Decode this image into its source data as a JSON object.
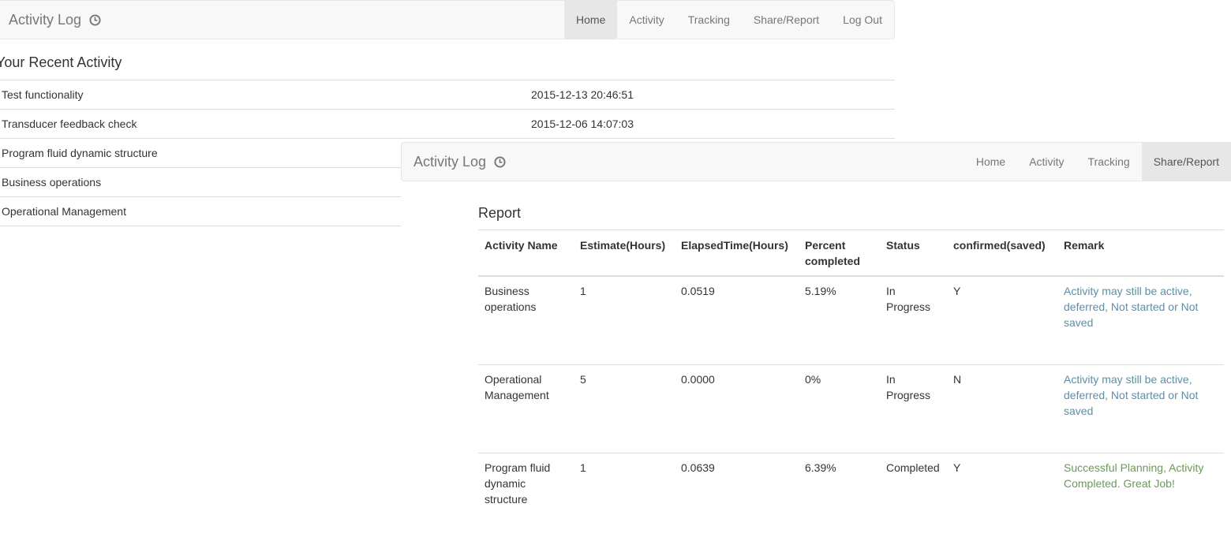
{
  "back_window": {
    "brand": "Activity Log",
    "nav": [
      "Home",
      "Activity",
      "Tracking",
      "Share/Report",
      "Log Out"
    ],
    "active_nav": "Home",
    "section_title": "Your Recent Activity",
    "recent": [
      {
        "name": "Test functionality",
        "time": "2015-12-13 20:46:51"
      },
      {
        "name": "Transducer feedback check",
        "time": "2015-12-06 14:07:03"
      },
      {
        "name": "Program fluid dynamic structure",
        "time": ""
      },
      {
        "name": "Business operations",
        "time": ""
      },
      {
        "name": "Operational Management",
        "time": ""
      }
    ]
  },
  "front_window": {
    "brand": "Activity Log",
    "nav": [
      "Home",
      "Activity",
      "Tracking",
      "Share/Report"
    ],
    "active_nav": "Share/Report",
    "report_title": "Report",
    "columns": [
      "Activity Name",
      "Estimate(Hours)",
      "ElapsedTime(Hours)",
      "Percent completed",
      "Status",
      "confirmed(saved)",
      "Remark"
    ],
    "rows": [
      {
        "name": "Business operations",
        "estimate": "1",
        "elapsed": "0.0519",
        "percent": "5.19%",
        "status": "In Progress",
        "confirmed": "Y",
        "remark": "Activity may still be active, deferred, Not started or Not saved",
        "remark_type": "info"
      },
      {
        "name": "Operational Management",
        "estimate": "5",
        "elapsed": "0.0000",
        "percent": "0%",
        "status": "In Progress",
        "confirmed": "N",
        "remark": "Activity may still be active, deferred, Not started or Not saved",
        "remark_type": "info"
      },
      {
        "name": "Program fluid dynamic structure",
        "estimate": "1",
        "elapsed": "0.0639",
        "percent": "6.39%",
        "status": "Completed",
        "confirmed": "Y",
        "remark": "Successful Planning, Activity Completed. Great Job!",
        "remark_type": "success"
      }
    ]
  },
  "colors": {
    "info_remark": "#5b8fa8",
    "success_remark": "#6a9a58",
    "navbar_bg": "#f8f8f8",
    "active_nav_bg": "#e7e7e7"
  },
  "icons": {
    "brand": "clock-icon"
  }
}
